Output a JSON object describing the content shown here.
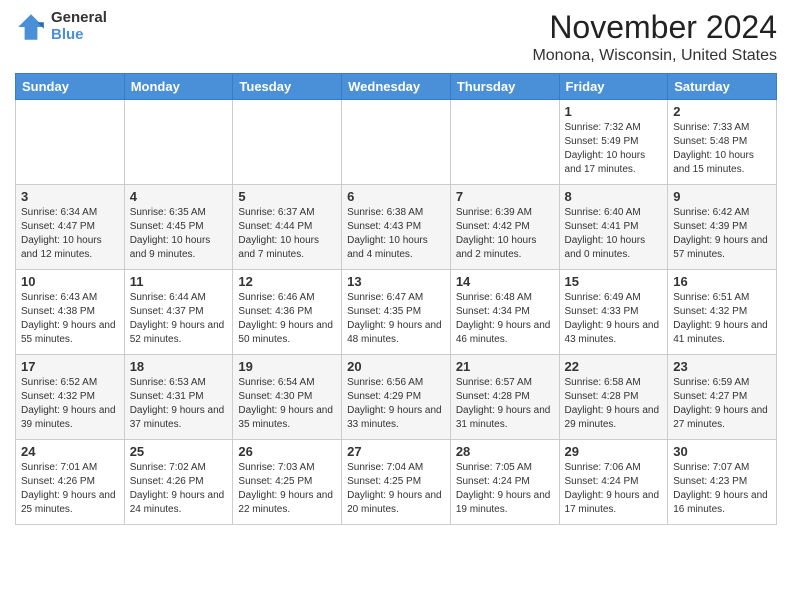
{
  "logo": {
    "general": "General",
    "blue": "Blue"
  },
  "title": "November 2024",
  "location": "Monona, Wisconsin, United States",
  "days_of_week": [
    "Sunday",
    "Monday",
    "Tuesday",
    "Wednesday",
    "Thursday",
    "Friday",
    "Saturday"
  ],
  "weeks": [
    [
      {
        "day": "",
        "info": ""
      },
      {
        "day": "",
        "info": ""
      },
      {
        "day": "",
        "info": ""
      },
      {
        "day": "",
        "info": ""
      },
      {
        "day": "",
        "info": ""
      },
      {
        "day": "1",
        "info": "Sunrise: 7:32 AM\nSunset: 5:49 PM\nDaylight: 10 hours and 17 minutes."
      },
      {
        "day": "2",
        "info": "Sunrise: 7:33 AM\nSunset: 5:48 PM\nDaylight: 10 hours and 15 minutes."
      }
    ],
    [
      {
        "day": "3",
        "info": "Sunrise: 6:34 AM\nSunset: 4:47 PM\nDaylight: 10 hours and 12 minutes."
      },
      {
        "day": "4",
        "info": "Sunrise: 6:35 AM\nSunset: 4:45 PM\nDaylight: 10 hours and 9 minutes."
      },
      {
        "day": "5",
        "info": "Sunrise: 6:37 AM\nSunset: 4:44 PM\nDaylight: 10 hours and 7 minutes."
      },
      {
        "day": "6",
        "info": "Sunrise: 6:38 AM\nSunset: 4:43 PM\nDaylight: 10 hours and 4 minutes."
      },
      {
        "day": "7",
        "info": "Sunrise: 6:39 AM\nSunset: 4:42 PM\nDaylight: 10 hours and 2 minutes."
      },
      {
        "day": "8",
        "info": "Sunrise: 6:40 AM\nSunset: 4:41 PM\nDaylight: 10 hours and 0 minutes."
      },
      {
        "day": "9",
        "info": "Sunrise: 6:42 AM\nSunset: 4:39 PM\nDaylight: 9 hours and 57 minutes."
      }
    ],
    [
      {
        "day": "10",
        "info": "Sunrise: 6:43 AM\nSunset: 4:38 PM\nDaylight: 9 hours and 55 minutes."
      },
      {
        "day": "11",
        "info": "Sunrise: 6:44 AM\nSunset: 4:37 PM\nDaylight: 9 hours and 52 minutes."
      },
      {
        "day": "12",
        "info": "Sunrise: 6:46 AM\nSunset: 4:36 PM\nDaylight: 9 hours and 50 minutes."
      },
      {
        "day": "13",
        "info": "Sunrise: 6:47 AM\nSunset: 4:35 PM\nDaylight: 9 hours and 48 minutes."
      },
      {
        "day": "14",
        "info": "Sunrise: 6:48 AM\nSunset: 4:34 PM\nDaylight: 9 hours and 46 minutes."
      },
      {
        "day": "15",
        "info": "Sunrise: 6:49 AM\nSunset: 4:33 PM\nDaylight: 9 hours and 43 minutes."
      },
      {
        "day": "16",
        "info": "Sunrise: 6:51 AM\nSunset: 4:32 PM\nDaylight: 9 hours and 41 minutes."
      }
    ],
    [
      {
        "day": "17",
        "info": "Sunrise: 6:52 AM\nSunset: 4:32 PM\nDaylight: 9 hours and 39 minutes."
      },
      {
        "day": "18",
        "info": "Sunrise: 6:53 AM\nSunset: 4:31 PM\nDaylight: 9 hours and 37 minutes."
      },
      {
        "day": "19",
        "info": "Sunrise: 6:54 AM\nSunset: 4:30 PM\nDaylight: 9 hours and 35 minutes."
      },
      {
        "day": "20",
        "info": "Sunrise: 6:56 AM\nSunset: 4:29 PM\nDaylight: 9 hours and 33 minutes."
      },
      {
        "day": "21",
        "info": "Sunrise: 6:57 AM\nSunset: 4:28 PM\nDaylight: 9 hours and 31 minutes."
      },
      {
        "day": "22",
        "info": "Sunrise: 6:58 AM\nSunset: 4:28 PM\nDaylight: 9 hours and 29 minutes."
      },
      {
        "day": "23",
        "info": "Sunrise: 6:59 AM\nSunset: 4:27 PM\nDaylight: 9 hours and 27 minutes."
      }
    ],
    [
      {
        "day": "24",
        "info": "Sunrise: 7:01 AM\nSunset: 4:26 PM\nDaylight: 9 hours and 25 minutes."
      },
      {
        "day": "25",
        "info": "Sunrise: 7:02 AM\nSunset: 4:26 PM\nDaylight: 9 hours and 24 minutes."
      },
      {
        "day": "26",
        "info": "Sunrise: 7:03 AM\nSunset: 4:25 PM\nDaylight: 9 hours and 22 minutes."
      },
      {
        "day": "27",
        "info": "Sunrise: 7:04 AM\nSunset: 4:25 PM\nDaylight: 9 hours and 20 minutes."
      },
      {
        "day": "28",
        "info": "Sunrise: 7:05 AM\nSunset: 4:24 PM\nDaylight: 9 hours and 19 minutes."
      },
      {
        "day": "29",
        "info": "Sunrise: 7:06 AM\nSunset: 4:24 PM\nDaylight: 9 hours and 17 minutes."
      },
      {
        "day": "30",
        "info": "Sunrise: 7:07 AM\nSunset: 4:23 PM\nDaylight: 9 hours and 16 minutes."
      }
    ]
  ]
}
